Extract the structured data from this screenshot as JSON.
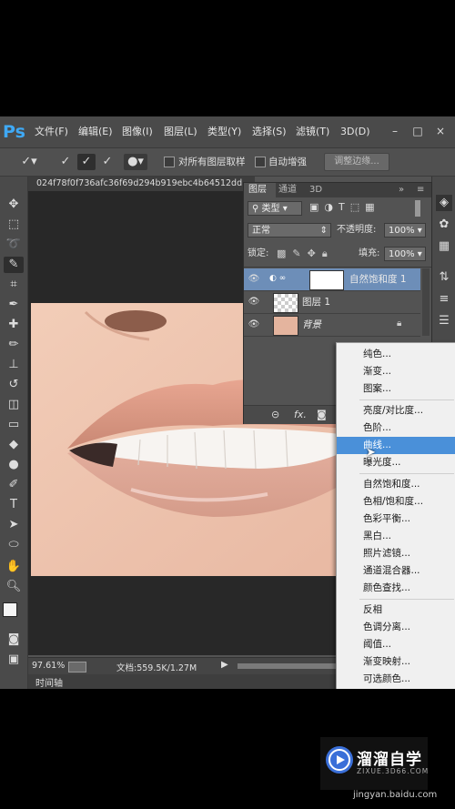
{
  "app": {
    "logo": "Ps",
    "menus": [
      "文件(F)",
      "编辑(E)",
      "图像(I)",
      "图层(L)",
      "类型(Y)",
      "选择(S)",
      "滤镜(T)",
      "3D(D)"
    ],
    "window_controls": [
      "–",
      "□",
      "×"
    ]
  },
  "options_bar": {
    "sample_all_layers_label": "对所有图层取样",
    "auto_enhance_label": "自动增强",
    "refine_edge_label": "调整边缘..."
  },
  "document": {
    "tab_title": "024f78f0f736afc36f69d294b919ebc4b64512dd",
    "zoom": "97.61%",
    "doc_info": "文档:559.5K/1.27M",
    "timeline_label": "时间轴"
  },
  "layers_panel": {
    "tabs": [
      "图层",
      "通道",
      "3D"
    ],
    "filter_label": "类型",
    "blend_mode": "正常",
    "opacity_label": "不透明度:",
    "opacity_value": "100%",
    "lock_label": "锁定:",
    "fill_label": "填充:",
    "fill_value": "100%",
    "layers": [
      {
        "name": "自然饱和度 1",
        "selected": true
      },
      {
        "name": "图层 1",
        "selected": false
      },
      {
        "name": "背景",
        "selected": false
      }
    ],
    "bottom_icons": [
      "link-icon",
      "fx-icon",
      "mask-icon",
      "adjustment-icon"
    ]
  },
  "context_menu": {
    "groups": [
      [
        "纯色...",
        "渐变...",
        "图案..."
      ],
      [
        "亮度/对比度...",
        "色阶...",
        "曲线...",
        "曝光度..."
      ],
      [
        "自然饱和度...",
        "色相/饱和度...",
        "色彩平衡...",
        "黑白...",
        "照片滤镜...",
        "通道混合器...",
        "颜色查找..."
      ],
      [
        "反相",
        "色调分离...",
        "阈值...",
        "渐变映射...",
        "可选颜色..."
      ]
    ],
    "highlighted": "曲线..."
  },
  "watermark": {
    "title": "溜溜自学",
    "subtitle": "ZIXUE.3D66.COM",
    "site": "jingyan.baidu.com"
  },
  "colors": {
    "accent": "#4a90d9",
    "ps_blue": "#3fa9f5"
  }
}
